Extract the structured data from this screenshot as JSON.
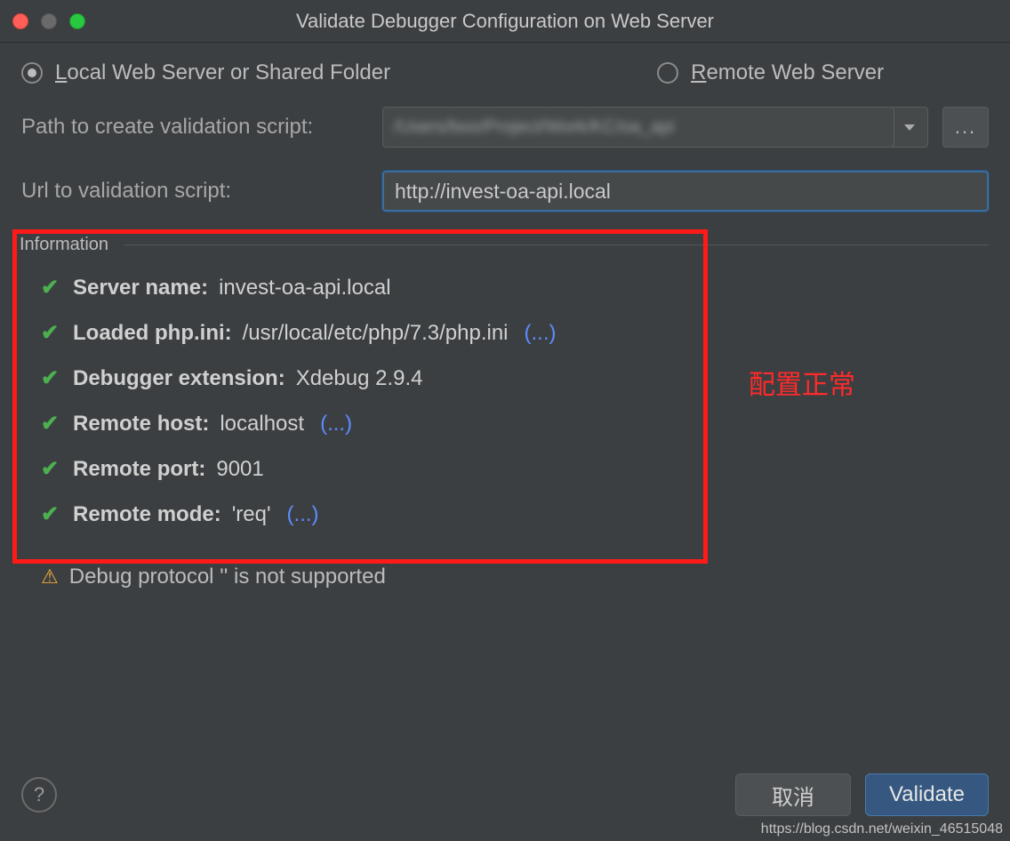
{
  "window": {
    "title": "Validate Debugger Configuration on Web Server"
  },
  "radios": {
    "local": {
      "label_pre": "L",
      "label_rest": "ocal Web Server or Shared Folder",
      "selected": true
    },
    "remote": {
      "label_pre": "R",
      "label_rest": "emote Web Server",
      "selected": false
    }
  },
  "form": {
    "path_label": "Path to create validation script:",
    "path_value": "/Users/boo/Project/Work/KC/oa_api",
    "browse_label": "...",
    "url_label": "Url to validation script:",
    "url_value": "http://invest-oa-api.local"
  },
  "info": {
    "legend": "Information",
    "items": [
      {
        "label": "Server name:",
        "value": "invest-oa-api.local",
        "more": ""
      },
      {
        "label": "Loaded php.ini:",
        "value": "/usr/local/etc/php/7.3/php.ini",
        "more": "(...)"
      },
      {
        "label": "Debugger extension:",
        "value": "Xdebug 2.9.4",
        "more": ""
      },
      {
        "label": "Remote host:",
        "value": "localhost",
        "more": "(...)"
      },
      {
        "label": "Remote port:",
        "value": "9001",
        "more": ""
      },
      {
        "label": "Remote mode:",
        "value": "'req'",
        "more": "(...)"
      }
    ],
    "warning": "Debug protocol '' is not supported"
  },
  "annotation": "配置正常",
  "buttons": {
    "help": "?",
    "cancel": "取消",
    "validate": "Validate"
  },
  "watermark": "https://blog.csdn.net/weixin_46515048"
}
